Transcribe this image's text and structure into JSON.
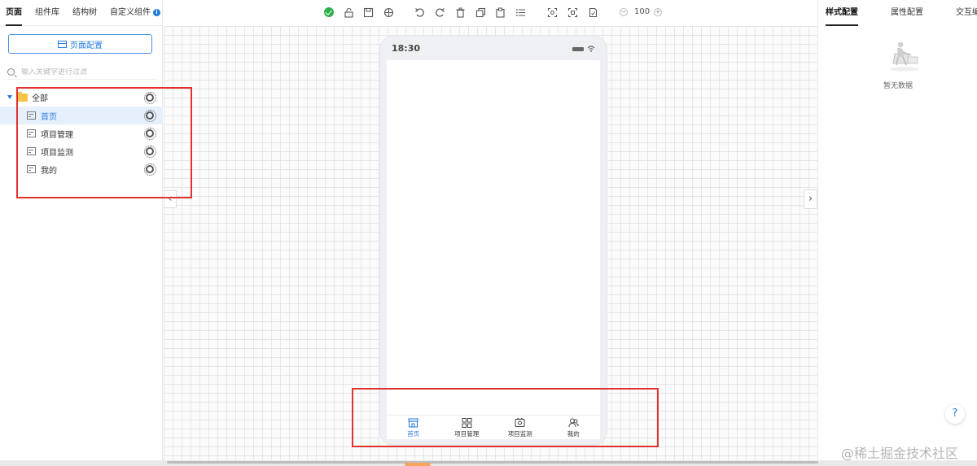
{
  "left_panel": {
    "tabs": [
      {
        "label": "页面"
      },
      {
        "label": "组件库"
      },
      {
        "label": "结构树"
      },
      {
        "label": "自定义组件"
      }
    ],
    "info_icon": "i",
    "page_config_label": "页面配置",
    "search_placeholder": "输入关键字进行过滤",
    "tree": {
      "root_label": "全部",
      "items": [
        {
          "label": "首页",
          "selected": true
        },
        {
          "label": "项目管理"
        },
        {
          "label": "项目监测"
        },
        {
          "label": "我的"
        }
      ]
    }
  },
  "toolbar": {
    "zoom_value": "100",
    "zoom_minus": "−",
    "zoom_plus": "+"
  },
  "phone": {
    "time": "18:30",
    "tabbar": [
      {
        "label": "首页",
        "icon": "store-icon",
        "active": true
      },
      {
        "label": "项目管理",
        "icon": "grid-icon"
      },
      {
        "label": "项目监测",
        "icon": "monitor-icon"
      },
      {
        "label": "我的",
        "icon": "user-icon"
      }
    ]
  },
  "right_panel": {
    "tabs": [
      {
        "label": "样式配置"
      },
      {
        "label": "属性配置"
      },
      {
        "label": "交互编辑"
      }
    ],
    "empty_text": "暂无数据",
    "help_label": "?"
  },
  "nav": {
    "collapse_left": "‹",
    "collapse_right": "›"
  },
  "watermark": "@稀土掘金技术社区",
  "colors": {
    "accent": "#2b7de0",
    "highlight_box": "#e03232",
    "success": "#29b04b",
    "folder": "#f6c447"
  }
}
